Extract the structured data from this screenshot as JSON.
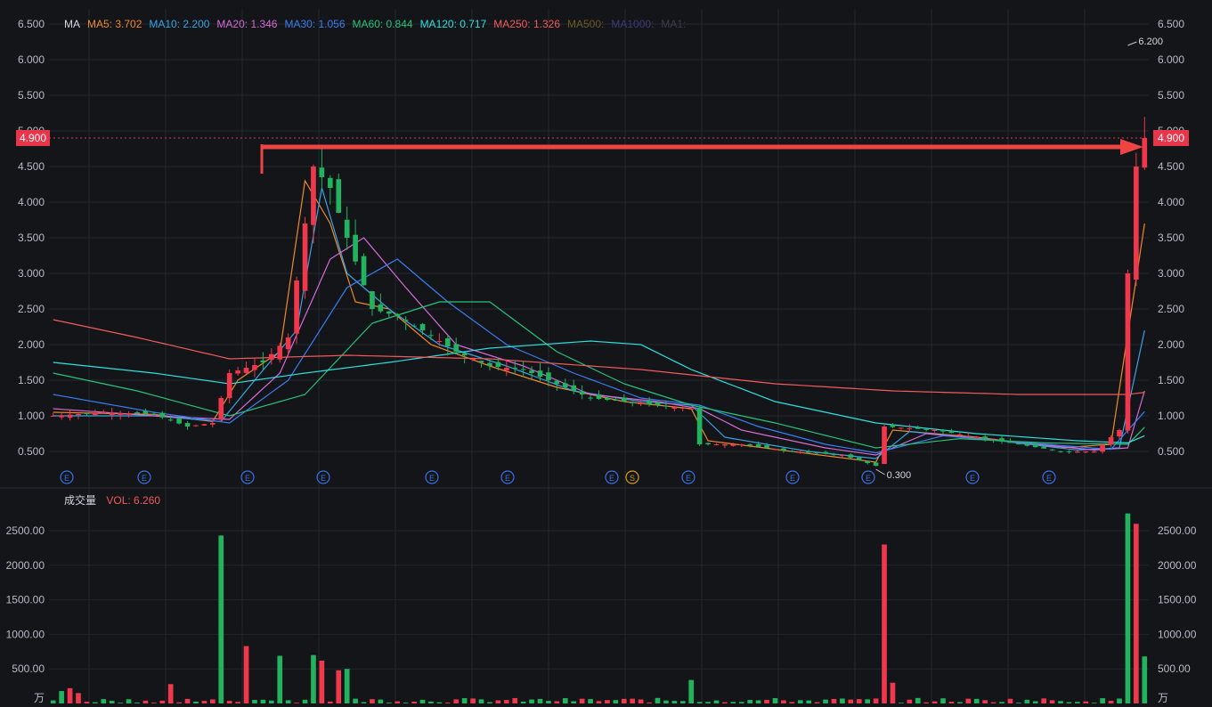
{
  "colors": {
    "background": "#131519",
    "grid": "#23262d",
    "axis_text": "#b8bcc6",
    "up": "#f0384c",
    "down": "#22b35e",
    "price_tag": "#e8354a",
    "arrow": "#ef4444",
    "event_marker": "#3b6fe0",
    "split_marker": "#d59b21"
  },
  "ma_legend": {
    "title": "MA",
    "items": [
      {
        "label": "MA5: 3.702",
        "color": "#ef8a2a"
      },
      {
        "label": "MA10: 2.200",
        "color": "#3aa3e6"
      },
      {
        "label": "MA20: 1.346",
        "color": "#d76ad8"
      },
      {
        "label": "MA30: 1.056",
        "color": "#3b7ef0"
      },
      {
        "label": "MA60: 0.844",
        "color": "#29c27a"
      },
      {
        "label": "MA120: 0.717",
        "color": "#2fe0e0"
      },
      {
        "label": "MA250: 1.326",
        "color": "#f25b5b"
      },
      {
        "label": "MA500:",
        "color": "#6b5a20"
      },
      {
        "label": "MA1000:",
        "color": "#3e3a78"
      },
      {
        "label": "MA1:",
        "color": "#3a3d45"
      }
    ]
  },
  "vol_legend": {
    "title": "成交量",
    "label": "VOL: 6.260",
    "color": "#f05b5b"
  },
  "current_price": "4.900",
  "high_annotation": "6.200",
  "low_annotation": "0.300",
  "volume_unit": "万",
  "event_markers": [
    "E",
    "E",
    "E",
    "E",
    "E",
    "E",
    "E",
    "S",
    "E",
    "E",
    "E",
    "E",
    "E"
  ],
  "chart_data": {
    "type": "candlestick",
    "price_axis": {
      "min": 0.25,
      "max": 6.6,
      "ticks": [
        "0.500",
        "1.000",
        "1.500",
        "2.000",
        "2.500",
        "3.000",
        "3.500",
        "4.000",
        "4.500",
        "5.000",
        "5.500",
        "6.000",
        "6.500"
      ]
    },
    "volume_axis": {
      "min": 0,
      "max": 2800,
      "ticks": [
        "500.00",
        "1000.00",
        "1500.00",
        "2000.00",
        "2500.00"
      ]
    },
    "last_price": 4.9,
    "high": 6.2,
    "low": 0.3,
    "close_path": [
      [
        0,
        1.0
      ],
      [
        6,
        1.05
      ],
      [
        12,
        1.02
      ],
      [
        16,
        0.85
      ],
      [
        19,
        0.9
      ],
      [
        21,
        1.6
      ],
      [
        25,
        1.75
      ],
      [
        28,
        2.1
      ],
      [
        31,
        4.5
      ],
      [
        33,
        4.2
      ],
      [
        35,
        3.5
      ],
      [
        38,
        2.5
      ],
      [
        41,
        2.4
      ],
      [
        44,
        2.2
      ],
      [
        48,
        1.9
      ],
      [
        52,
        1.7
      ],
      [
        56,
        1.65
      ],
      [
        60,
        1.45
      ],
      [
        64,
        1.25
      ],
      [
        68,
        1.2
      ],
      [
        72,
        1.15
      ],
      [
        76,
        1.1
      ],
      [
        77,
        0.6
      ],
      [
        82,
        0.6
      ],
      [
        88,
        0.5
      ],
      [
        94,
        0.45
      ],
      [
        98,
        0.3
      ],
      [
        99,
        0.85
      ],
      [
        105,
        0.8
      ],
      [
        110,
        0.7
      ],
      [
        115,
        0.6
      ],
      [
        120,
        0.5
      ],
      [
        124,
        0.5
      ],
      [
        127,
        0.8
      ],
      [
        128,
        3.0
      ],
      [
        129,
        4.5
      ],
      [
        130,
        4.9
      ]
    ],
    "ma_lines": {
      "MA5": [
        [
          0,
          1.05
        ],
        [
          12,
          1.02
        ],
        [
          19,
          0.92
        ],
        [
          22,
          1.5
        ],
        [
          27,
          1.9
        ],
        [
          30,
          4.3
        ],
        [
          33,
          3.7
        ],
        [
          36,
          2.6
        ],
        [
          40,
          2.5
        ],
        [
          45,
          2.0
        ],
        [
          52,
          1.7
        ],
        [
          60,
          1.4
        ],
        [
          68,
          1.2
        ],
        [
          76,
          1.1
        ],
        [
          78,
          0.65
        ],
        [
          88,
          0.5
        ],
        [
          98,
          0.35
        ],
        [
          100,
          0.8
        ],
        [
          110,
          0.7
        ],
        [
          120,
          0.55
        ],
        [
          126,
          0.6
        ],
        [
          130,
          3.7
        ]
      ],
      "MA10": [
        [
          0,
          1.0
        ],
        [
          12,
          1.0
        ],
        [
          20,
          0.92
        ],
        [
          24,
          1.5
        ],
        [
          29,
          2.2
        ],
        [
          32,
          4.2
        ],
        [
          35,
          3.0
        ],
        [
          40,
          2.5
        ],
        [
          46,
          2.0
        ],
        [
          54,
          1.7
        ],
        [
          62,
          1.35
        ],
        [
          70,
          1.2
        ],
        [
          76,
          1.15
        ],
        [
          80,
          0.7
        ],
        [
          90,
          0.5
        ],
        [
          98,
          0.4
        ],
        [
          102,
          0.78
        ],
        [
          112,
          0.66
        ],
        [
          122,
          0.52
        ],
        [
          127,
          0.55
        ],
        [
          130,
          2.2
        ]
      ],
      "MA20": [
        [
          0,
          1.1
        ],
        [
          12,
          1.0
        ],
        [
          21,
          0.95
        ],
        [
          27,
          1.6
        ],
        [
          33,
          3.2
        ],
        [
          37,
          3.5
        ],
        [
          42,
          2.8
        ],
        [
          48,
          2.0
        ],
        [
          56,
          1.7
        ],
        [
          64,
          1.3
        ],
        [
          72,
          1.2
        ],
        [
          77,
          1.1
        ],
        [
          82,
          0.8
        ],
        [
          92,
          0.55
        ],
        [
          98,
          0.45
        ],
        [
          104,
          0.75
        ],
        [
          114,
          0.64
        ],
        [
          124,
          0.52
        ],
        [
          128,
          0.55
        ],
        [
          130,
          1.35
        ]
      ],
      "MA30": [
        [
          0,
          1.3
        ],
        [
          12,
          1.05
        ],
        [
          21,
          0.9
        ],
        [
          28,
          1.5
        ],
        [
          35,
          2.8
        ],
        [
          41,
          3.2
        ],
        [
          47,
          2.6
        ],
        [
          54,
          2.0
        ],
        [
          62,
          1.6
        ],
        [
          70,
          1.25
        ],
        [
          77,
          1.15
        ],
        [
          84,
          0.85
        ],
        [
          92,
          0.6
        ],
        [
          98,
          0.48
        ],
        [
          106,
          0.72
        ],
        [
          116,
          0.62
        ],
        [
          126,
          0.53
        ],
        [
          130,
          1.06
        ]
      ],
      "MA60": [
        [
          0,
          1.6
        ],
        [
          10,
          1.35
        ],
        [
          21,
          1.0
        ],
        [
          30,
          1.3
        ],
        [
          38,
          2.3
        ],
        [
          46,
          2.6
        ],
        [
          52,
          2.6
        ],
        [
          60,
          1.9
        ],
        [
          68,
          1.45
        ],
        [
          76,
          1.15
        ],
        [
          86,
          0.9
        ],
        [
          98,
          0.55
        ],
        [
          108,
          0.68
        ],
        [
          118,
          0.62
        ],
        [
          128,
          0.6
        ],
        [
          130,
          0.84
        ]
      ],
      "MA120": [
        [
          0,
          1.75
        ],
        [
          12,
          1.6
        ],
        [
          21,
          1.45
        ],
        [
          30,
          1.6
        ],
        [
          40,
          1.75
        ],
        [
          52,
          1.95
        ],
        [
          64,
          2.05
        ],
        [
          70,
          2.0
        ],
        [
          76,
          1.65
        ],
        [
          86,
          1.2
        ],
        [
          98,
          0.9
        ],
        [
          110,
          0.75
        ],
        [
          122,
          0.65
        ],
        [
          128,
          0.62
        ],
        [
          130,
          0.72
        ]
      ],
      "MA250": [
        [
          0,
          2.35
        ],
        [
          10,
          2.1
        ],
        [
          21,
          1.8
        ],
        [
          35,
          1.85
        ],
        [
          52,
          1.8
        ],
        [
          70,
          1.65
        ],
        [
          86,
          1.45
        ],
        [
          100,
          1.35
        ],
        [
          115,
          1.3
        ],
        [
          128,
          1.3
        ],
        [
          130,
          1.33
        ]
      ]
    },
    "volume_spikes": [
      [
        1,
        180
      ],
      [
        2,
        220
      ],
      [
        3,
        150
      ],
      [
        14,
        280
      ],
      [
        20,
        2430
      ],
      [
        23,
        830
      ],
      [
        27,
        690
      ],
      [
        31,
        700
      ],
      [
        32,
        620
      ],
      [
        34,
        480
      ],
      [
        35,
        500
      ],
      [
        76,
        340
      ],
      [
        99,
        2300
      ],
      [
        100,
        300
      ],
      [
        128,
        2750
      ],
      [
        129,
        2600
      ],
      [
        130,
        680
      ]
    ]
  }
}
